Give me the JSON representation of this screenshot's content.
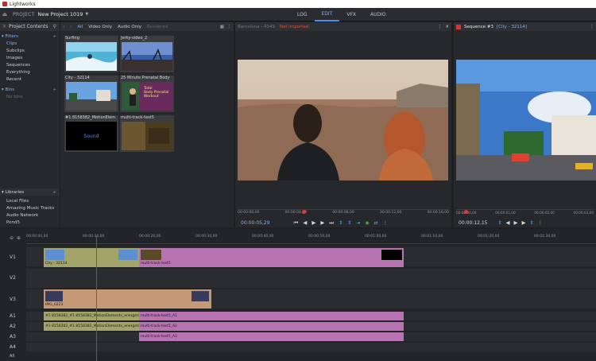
{
  "window": {
    "title": "Lightworks"
  },
  "topbar": {
    "project_label": "PROJECT",
    "project_name": "New Project 1019"
  },
  "tabs": [
    "LOG",
    "EDIT",
    "VFX",
    "AUDIO"
  ],
  "active_tab": "EDIT",
  "project_contents": {
    "title": "Project Contents",
    "filters_title": "Filters",
    "filters": [
      "Clips",
      "Subclips",
      "Images",
      "Sequences",
      "Everything",
      "Recent"
    ],
    "bins_title": "Bins",
    "bins_empty": "No bins",
    "libraries_title": "Libraries",
    "libraries": [
      "Local Files",
      "Amazing Music Tracks",
      "Audio Network",
      "Pond5"
    ]
  },
  "browser": {
    "filters": [
      "All",
      "Video Only",
      "Audio Only",
      "Rendered"
    ],
    "clips": [
      {
        "name": "Surfing"
      },
      {
        "name": "Jerky-video_2"
      },
      {
        "name": "City - 32114"
      },
      {
        "name": "25 Minute Prenatal Body"
      },
      {
        "name": "#1 8158382_MotionElem"
      },
      {
        "name": "multi-track-test5"
      }
    ],
    "sound_label": "Sound",
    "overlay_text": [
      "Total",
      "Body Prenatal",
      "Workout"
    ]
  },
  "viewer": {
    "clip_name": "Barcelona - 4349",
    "status": "Not imported",
    "ruler": [
      "00:00:00,00",
      "00:00:04,00",
      "00:00:08,00",
      "00:00:12,00",
      "00:00:16,00"
    ],
    "timecode": "00:00:05,29"
  },
  "sequence": {
    "title": "Sequence #3",
    "subtitle": "[City - 32114]",
    "ruler": [
      "00:00:00,00",
      "00:00:01,00",
      "00:00:02,00",
      "00:00:03,00"
    ],
    "timecode": "00:00:12,15"
  },
  "timeline": {
    "ruler": [
      "00:00:00,00",
      "00:00:10,00",
      "00:00:20,00",
      "00:00:30,00",
      "00:00:40,00",
      "00:00:50,00",
      "00:01:00,00",
      "00:01:10,00",
      "00:01:20,00",
      "00:01:30,00"
    ],
    "tracks": [
      "V1",
      "V2",
      "V3",
      "A1",
      "A2",
      "A3",
      "A4"
    ],
    "all_label": "All",
    "segments": {
      "v1a": "City - 32114",
      "v1b": "multi-track-test5",
      "v3": "IMG_0223",
      "a1a": "#1 8158382_#1 8158382_MotionElements_energetic-b",
      "a1b": "multi-track-test5_A1",
      "a2a": "#1 8158382_#1 8158382_MotionElements_energetic-b",
      "a2b": "multi-track-test5_A2",
      "a3": "multi-track-test5_A3"
    }
  }
}
